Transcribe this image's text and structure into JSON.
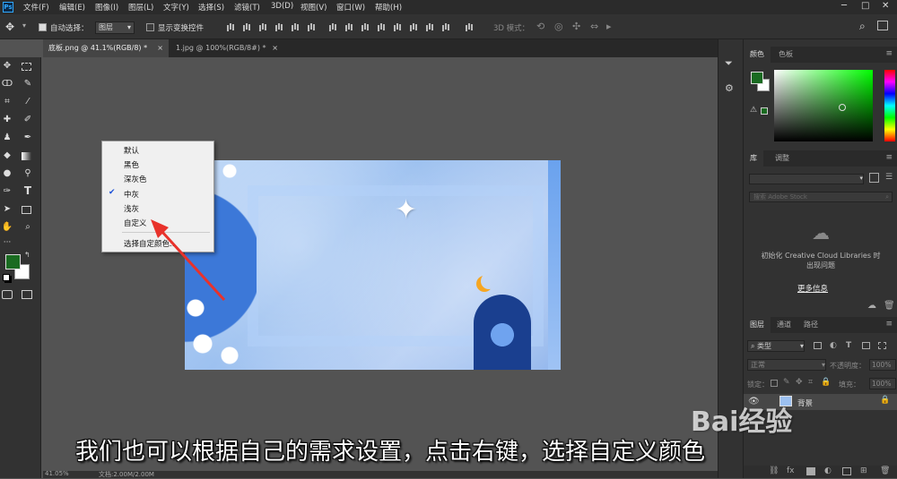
{
  "menubar": {
    "logo": "Ps",
    "items": [
      "文件(F)",
      "编辑(E)",
      "图像(I)",
      "图层(L)",
      "文字(Y)",
      "选择(S)",
      "滤镜(T)",
      "3D(D)",
      "视图(V)",
      "窗口(W)",
      "帮助(H)"
    ]
  },
  "optbar": {
    "auto_select_label": "自动选择：",
    "auto_select_value": "图层",
    "show_transform_label": "显示变换控件",
    "mode_3d_label": "3D 模式："
  },
  "tabs": [
    {
      "label": "底板.png @ 41.1%(RGB/8) *"
    },
    {
      "label": "1.jpg @ 100%(RGB/8#) *"
    }
  ],
  "context_menu": {
    "items": [
      "默认",
      "黑色",
      "深灰色",
      "中灰",
      "浅灰",
      "自定义",
      "选择自定颜色..."
    ],
    "checked_index": 3
  },
  "color_panel": {
    "tabs": [
      "颜色",
      "色板"
    ],
    "foreground": "#1a6b21",
    "picker_hue": "#00ff00"
  },
  "library_panel": {
    "tabs": [
      "库",
      "调整"
    ],
    "search_placeholder": "搜索 Adobe Stock",
    "init_text": "初始化 Creative Cloud Libraries 时出现问题",
    "more_link": "更多信息"
  },
  "layers_panel": {
    "tabs": [
      "图层",
      "通道",
      "路径"
    ],
    "kind_label": "类型",
    "blend_mode": "正常",
    "opacity_label": "不透明度：",
    "opacity_value": "100%",
    "lock_label": "锁定：",
    "fill_label": "填充：",
    "fill_value": "100%",
    "layer_name": "背景"
  },
  "caption": "我们也可以根据自己的需求设置，点击右键，选择自定义颜色",
  "status": {
    "zoom": "41.05%",
    "doc": "文档:2.00M/2.00M"
  },
  "watermark": "Bai经验"
}
